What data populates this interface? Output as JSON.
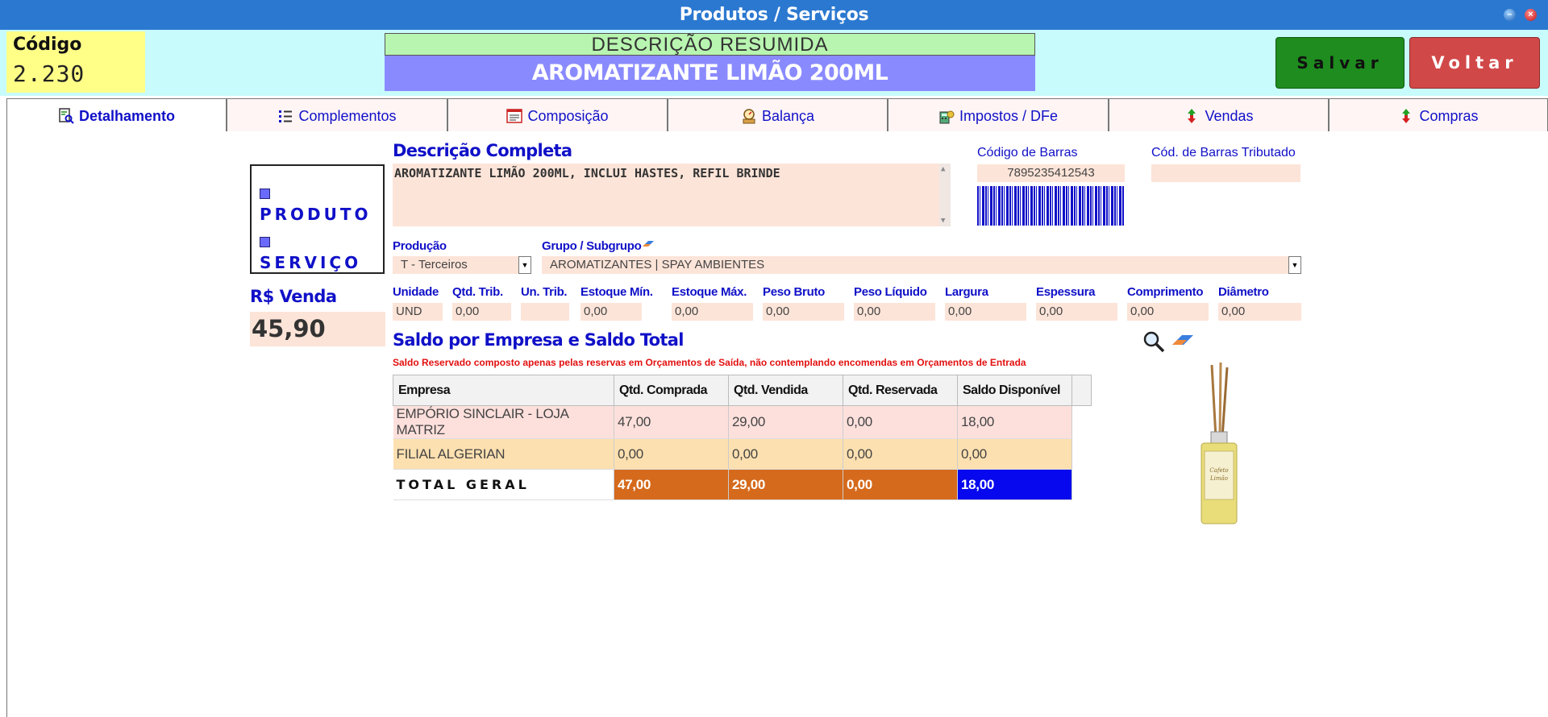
{
  "window": {
    "title": "Produtos / Serviços"
  },
  "header": {
    "code_label": "Código",
    "code_value": "2.230",
    "desc_resumida_label": "DESCRIÇÃO RESUMIDA",
    "desc_resumida_value": "AROMATIZANTE LIMÃO 200ML",
    "save_label": "Salvar",
    "back_label": "Voltar"
  },
  "tabs": [
    {
      "label": "Detalhamento",
      "icon": "document-search-icon",
      "active": true
    },
    {
      "label": "Complementos",
      "icon": "list-icon"
    },
    {
      "label": "Composição",
      "icon": "form-icon"
    },
    {
      "label": "Balança",
      "icon": "scale-icon"
    },
    {
      "label": "Impostos / DFe",
      "icon": "tax-icon"
    },
    {
      "label": "Vendas",
      "icon": "up-down-arrows-icon"
    },
    {
      "label": "Compras",
      "icon": "up-down-arrows-icon"
    }
  ],
  "type_selector": {
    "produto": "PRODUTO",
    "servico": "SERVIÇO"
  },
  "price": {
    "label": "R$ Venda",
    "value": "45,90"
  },
  "description": {
    "label": "Descrição Completa",
    "value": "AROMATIZANTE LIMÃO 200ML, INCLUI HASTES, REFIL BRINDE"
  },
  "barcode": {
    "label": "Código de Barras",
    "value": "7895235412543",
    "tributado_label": "Cód. de Barras Tributado",
    "tributado_value": ""
  },
  "production": {
    "label": "Produção",
    "value": "T - Terceiros"
  },
  "group": {
    "label": "Grupo / Subgrupo",
    "value": "AROMATIZANTES | SPAY AMBIENTES"
  },
  "measures": [
    {
      "label": "Unidade",
      "value": "UND"
    },
    {
      "label": "Qtd. Trib.",
      "value": "0,00"
    },
    {
      "label": "Un. Trib.",
      "value": ""
    },
    {
      "label": "Estoque Mín.",
      "value": "0,00"
    },
    {
      "label": "Estoque Máx.",
      "value": "0,00"
    },
    {
      "label": "Peso Bruto",
      "value": "0,00"
    },
    {
      "label": "Peso Líquido",
      "value": "0,00"
    },
    {
      "label": "Largura",
      "value": "0,00"
    },
    {
      "label": "Espessura",
      "value": "0,00"
    },
    {
      "label": "Comprimento",
      "value": "0,00"
    },
    {
      "label": "Diâmetro",
      "value": "0,00"
    }
  ],
  "saldo": {
    "title": "Saldo por Empresa e Saldo Total",
    "note": "Saldo Reservado composto apenas pelas reservas em Orçamentos de Saída, não contemplando encomendas em Orçamentos de Entrada",
    "columns": [
      "Empresa",
      "Qtd. Comprada",
      "Qtd. Vendida",
      "Qtd. Reservada",
      "Saldo Disponível"
    ],
    "rows": [
      [
        "EMPÓRIO SINCLAIR - LOJA MATRIZ",
        "47,00",
        "29,00",
        "0,00",
        "18,00"
      ],
      [
        "FILIAL ALGERIAN",
        "0,00",
        "0,00",
        "0,00",
        "0,00"
      ]
    ],
    "total": [
      "TOTAL GERAL",
      "47,00",
      "29,00",
      "0,00",
      "18,00"
    ]
  },
  "product_image": {
    "label_line1": "Cafeto",
    "label_line2": "Limão"
  },
  "colors": {
    "accent": "#1010c8",
    "titlebar": "#2b78d0",
    "field_bg": "#fde4d8",
    "save": "#1e8c1e",
    "back": "#d14848",
    "total_orange": "#d56a1c",
    "total_blue": "#0808ee"
  }
}
